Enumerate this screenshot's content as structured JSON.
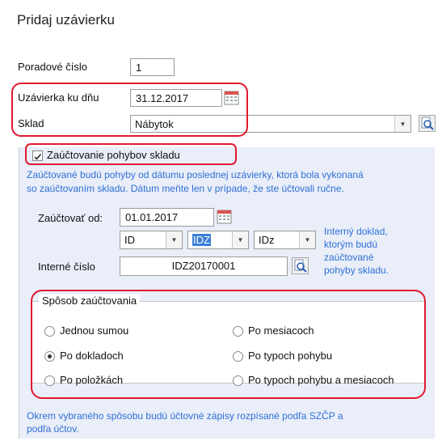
{
  "title": "Pridaj uzávierku",
  "form": {
    "order_label": "Poradové číslo",
    "order_value": "1",
    "closing_date_label": "Uzávierka ku dňu",
    "closing_date_value": "31.12.2017",
    "warehouse_label": "Sklad",
    "warehouse_value": "Nábytok"
  },
  "posting": {
    "checkbox_label": "Zaúčtovanie pohybov skladu",
    "checked": true,
    "hint_line1": "Zaúčtované budú pohyby od dátumu poslednej uzávierky, ktorá bola vykonaná",
    "hint_line2": "so zaúčtovaním skladu. Dátum meňte len v prípade, že ste účtovali ručne.",
    "post_from_label": "Zaúčtovať od:",
    "post_from_value": "01.01.2017",
    "combo1": "ID",
    "combo2": "IDZ",
    "combo3": "IDz",
    "internal_label": "Interné číslo",
    "internal_value": "IDZ20170001",
    "side_hint_1": "Interný doklad,",
    "side_hint_2": "ktorým budú",
    "side_hint_3": "zaúčtované",
    "side_hint_4": "pohyby skladu."
  },
  "method": {
    "group_title": "Spôsob zaúčtovania",
    "options": [
      "Jednou sumou",
      "Po dokladoch",
      "Po položkách",
      "Po mesiacoch",
      "Po typoch pohybu",
      "Po typoch pohybu a mesiacoch"
    ],
    "selected": "Po dokladoch",
    "footer_line1": "Okrem vybraného spôsobu budú účtovné zápisy rozpísané podľa SZČP a",
    "footer_line2": "podľa účtov."
  },
  "colors": {
    "highlight": "#e0192f",
    "hint": "#2f6fd6",
    "panel": "#e9eef8"
  }
}
